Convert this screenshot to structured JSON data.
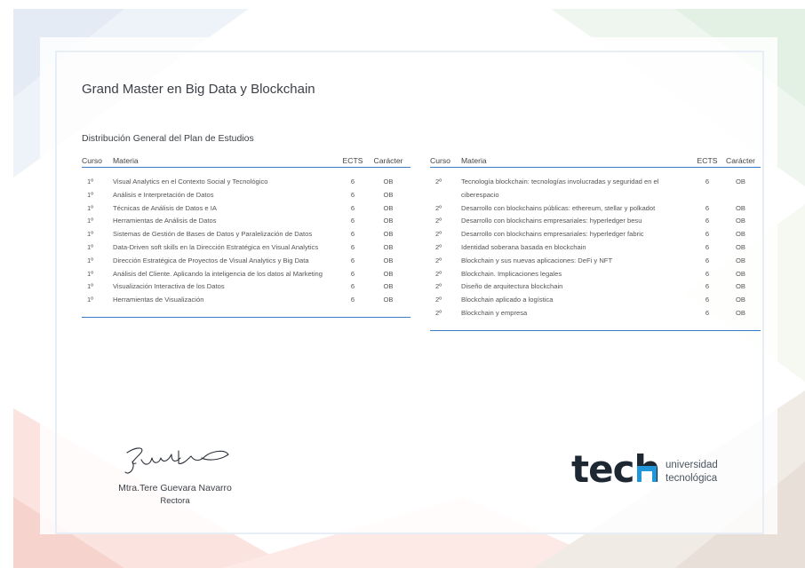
{
  "title": "Grand Master en Big Data y Blockchain",
  "subtitle": "Distribución General del Plan de Estudios",
  "headers": {
    "curso": "Curso",
    "materia": "Materia",
    "ects": "ECTS",
    "caracter": "Carácter"
  },
  "left_rows": [
    {
      "curso": "1º",
      "materia": "Visual Analytics en el Contexto Social y Tecnológico",
      "ects": "6",
      "caracter": "OB"
    },
    {
      "curso": "1º",
      "materia": "Análisis e Interpretación de Datos",
      "ects": "6",
      "caracter": "OB"
    },
    {
      "curso": "1º",
      "materia": "Técnicas de Análisis de Datos e IA",
      "ects": "6",
      "caracter": "OB"
    },
    {
      "curso": "1º",
      "materia": "Herramientas de Análisis de Datos",
      "ects": "6",
      "caracter": "OB"
    },
    {
      "curso": "1º",
      "materia": "Sistemas de Gestión de Bases de Datos y Paralelización de Datos",
      "ects": "6",
      "caracter": "OB"
    },
    {
      "curso": "1º",
      "materia": "Data-Driven soft skills en la Dirección Estratégica en Visual Analytics",
      "ects": "6",
      "caracter": "OB"
    },
    {
      "curso": "1º",
      "materia": "Dirección Estratégica de Proyectos de Visual Analytics y Big Data",
      "ects": "6",
      "caracter": "OB"
    },
    {
      "curso": "1º",
      "materia": "Análisis del Cliente. Aplicando la inteligencia de los datos al Marketing",
      "ects": "6",
      "caracter": "OB"
    },
    {
      "curso": "1º",
      "materia": "Visualización Interactiva de los Datos",
      "ects": "6",
      "caracter": "OB"
    },
    {
      "curso": "1º",
      "materia": "Herramientas de Visualización",
      "ects": "6",
      "caracter": "OB"
    }
  ],
  "right_rows": [
    {
      "curso": "2º",
      "materia": "Tecnología blockchain: tecnologías involucradas y seguridad en el ciberespacio",
      "ects": "6",
      "caracter": "OB"
    },
    {
      "curso": "2º",
      "materia": "Desarrollo con blockchains públicas: ethereum, stellar y polkadot",
      "ects": "6",
      "caracter": "OB"
    },
    {
      "curso": "2º",
      "materia": "Desarrollo con blockchains empresariales: hyperledger besu",
      "ects": "6",
      "caracter": "OB"
    },
    {
      "curso": "2º",
      "materia": "Desarrollo con blockchains empresariales: hyperledger fabric",
      "ects": "6",
      "caracter": "OB"
    },
    {
      "curso": "2º",
      "materia": "Identidad soberana basada en blockchain",
      "ects": "6",
      "caracter": "OB"
    },
    {
      "curso": "2º",
      "materia": "Blockchain y sus nuevas aplicaciones: DeFi y NFT",
      "ects": "6",
      "caracter": "OB"
    },
    {
      "curso": "2º",
      "materia": "Blockchain. Implicaciones legales",
      "ects": "6",
      "caracter": "OB"
    },
    {
      "curso": "2º",
      "materia": "Diseño de arquitectura blockchain",
      "ects": "6",
      "caracter": "OB"
    },
    {
      "curso": "2º",
      "materia": "Blockchain aplicado a logística",
      "ects": "6",
      "caracter": "OB"
    },
    {
      "curso": "2º",
      "materia": "Blockchain y empresa",
      "ects": "6",
      "caracter": "OB"
    }
  ],
  "signature": {
    "name": "Mtra.Tere Guevara Navarro",
    "role": "Rectora"
  },
  "logo": {
    "word": "tech",
    "line1": "universidad",
    "line2": "tecnológica"
  },
  "colors": {
    "accent": "#3a7bc8",
    "logo_dark": "#1d2833",
    "logo_accent": "#2196d9"
  }
}
